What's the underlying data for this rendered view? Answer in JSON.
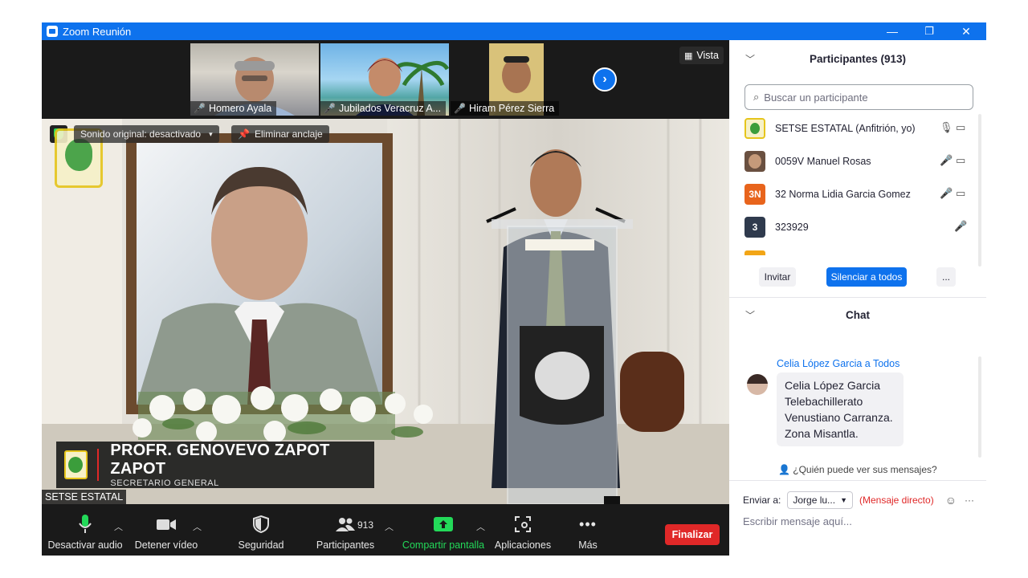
{
  "window": {
    "title": "Zoom Reunión",
    "controls": {
      "minimize": "—",
      "restore": "❐",
      "close": "✕"
    }
  },
  "thumbnails": [
    {
      "name": "Homero Ayala",
      "muted": true
    },
    {
      "name": "Jubilados Veracruz A...",
      "muted": true
    },
    {
      "name": "Hiram Pérez Sierra",
      "muted": true
    }
  ],
  "view_button": "Vista",
  "stage": {
    "original_sound": "Sonido original: desactivado",
    "unpin": "Eliminar anclaje",
    "speaker_name": "PROFR. GENOVEVO ZAPOT ZAPOT",
    "speaker_role": "SECRETARIO GENERAL",
    "name_tag": "SETSE ESTATAL"
  },
  "toolbar": {
    "audio": "Desactivar audio",
    "video": "Detener vídeo",
    "security": "Seguridad",
    "participants": "Participantes",
    "participants_count": "913",
    "share": "Compartir pantalla",
    "apps": "Aplicaciones",
    "more": "Más",
    "end": "Finalizar"
  },
  "participants_panel": {
    "title": "Participantes (913)",
    "search_placeholder": "Buscar un participante",
    "participants": [
      {
        "name": "SETSE ESTATAL (Anfitrión, yo)",
        "avatar": "logo",
        "mic": "on",
        "video": "off"
      },
      {
        "name": "0059V Manuel Rosas",
        "avatar": "photo",
        "mic": "muted",
        "video": "off"
      },
      {
        "name": "32 Norma Lidia Garcia Gomez",
        "avatar_text": "3N",
        "avatar_color": "#e8641c",
        "mic": "muted",
        "video": "off"
      },
      {
        "name": "323929",
        "avatar_text": "3",
        "avatar_color": "#2f3a4d",
        "mic": "muted"
      }
    ],
    "invite": "Invitar",
    "mute_all": "Silenciar a todos",
    "more": "..."
  },
  "chat": {
    "title": "Chat",
    "sender": "Celia López Garcia a Todos",
    "message_lines": [
      "Celia López Garcia",
      "Telebachillerato",
      "Venustiano Carranza.",
      "Zona Misantla."
    ],
    "who_can_see": "¿Quién puede ver sus mensajes?",
    "send_to_label": "Enviar a:",
    "send_to_value": "Jorge lu...",
    "direct_message": "(Mensaje directo)",
    "compose_placeholder": "Escribir mensaje aquí..."
  },
  "colors": {
    "accent": "#0e72ed",
    "end": "#e02828",
    "share": "#23d959",
    "muted": "#e02828"
  }
}
